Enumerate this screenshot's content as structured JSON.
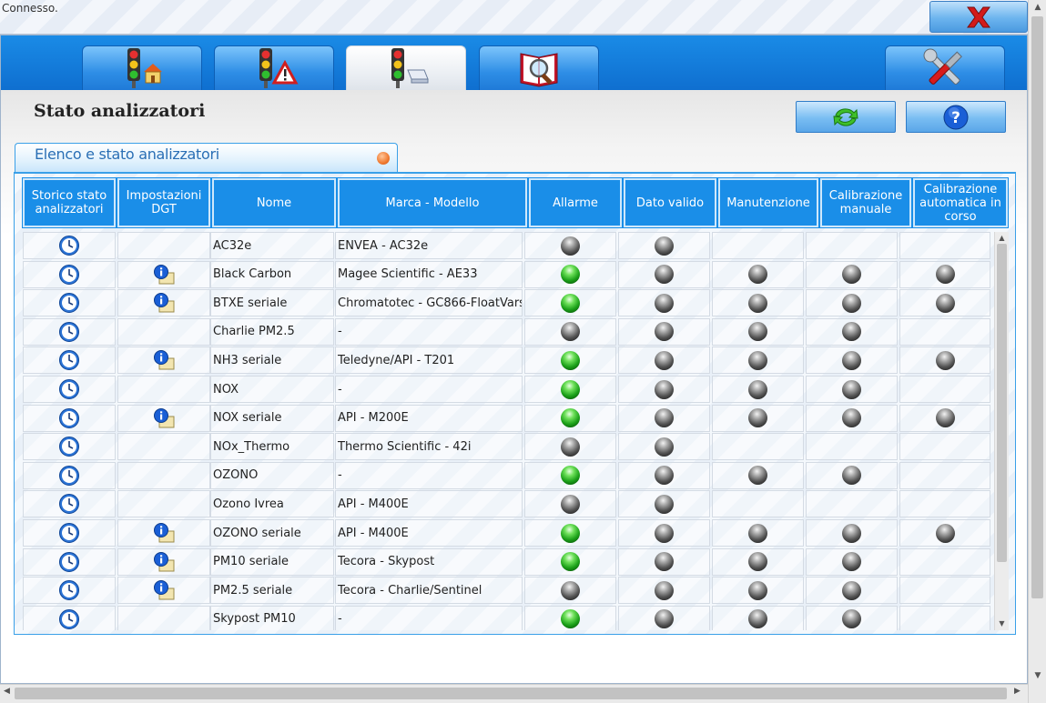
{
  "status": {
    "text": "Connesso."
  },
  "window": {
    "close_icon": "close-x-icon"
  },
  "tabs": [
    {
      "name": "tab-station-status",
      "icon": "traffic-light-home-icon",
      "active": false
    },
    {
      "name": "tab-alarms",
      "icon": "traffic-light-warning-icon",
      "active": false
    },
    {
      "name": "tab-analyzers",
      "icon": "traffic-light-device-icon",
      "active": true
    },
    {
      "name": "tab-data-search",
      "icon": "book-magnifier-icon",
      "active": false
    },
    {
      "name": "tab-settings",
      "icon": "tools-icon",
      "active": false
    }
  ],
  "page": {
    "title": "Stato analizzatori"
  },
  "buttons": {
    "refresh_icon": "refresh-icon",
    "help_icon": "help-icon"
  },
  "panel": {
    "title": "Elenco e stato analizzatori"
  },
  "table": {
    "headers": [
      "Storico stato analizzatori",
      "Impostazioni DGT",
      "Nome",
      "Marca - Modello",
      "Allarme",
      "Dato valido",
      "Manutenzione",
      "Calibrazione manuale",
      "Calibrazione automatica in corso"
    ],
    "rows": [
      {
        "info": false,
        "name": "AC32e",
        "model": "ENVEA - AC32e",
        "allarme": "grey",
        "valido": "grey",
        "manut": "",
        "calman": "",
        "calauto": ""
      },
      {
        "info": true,
        "name": "Black Carbon",
        "model": "Magee Scientific - AE33",
        "allarme": "green",
        "valido": "grey",
        "manut": "grey",
        "calman": "grey",
        "calauto": "grey"
      },
      {
        "info": true,
        "name": "BTXE seriale",
        "model": "Chromatotec - GC866-FloatVars",
        "allarme": "green",
        "valido": "grey",
        "manut": "grey",
        "calman": "grey",
        "calauto": "grey"
      },
      {
        "info": false,
        "name": "Charlie PM2.5",
        "model": "-",
        "allarme": "grey",
        "valido": "grey",
        "manut": "grey",
        "calman": "grey",
        "calauto": ""
      },
      {
        "info": true,
        "name": "NH3 seriale",
        "model": "Teledyne/API - T201",
        "allarme": "green",
        "valido": "grey",
        "manut": "grey",
        "calman": "grey",
        "calauto": "grey"
      },
      {
        "info": false,
        "name": "NOX",
        "model": "-",
        "allarme": "green",
        "valido": "grey",
        "manut": "grey",
        "calman": "grey",
        "calauto": ""
      },
      {
        "info": true,
        "name": "NOX seriale",
        "model": "API - M200E",
        "allarme": "green",
        "valido": "grey",
        "manut": "grey",
        "calman": "grey",
        "calauto": "grey"
      },
      {
        "info": false,
        "name": "NOx_Thermo",
        "model": "Thermo Scientific - 42i",
        "allarme": "grey",
        "valido": "grey",
        "manut": "",
        "calman": "",
        "calauto": ""
      },
      {
        "info": false,
        "name": "OZONO",
        "model": "-",
        "allarme": "green",
        "valido": "grey",
        "manut": "grey",
        "calman": "grey",
        "calauto": ""
      },
      {
        "info": false,
        "name": "Ozono Ivrea",
        "model": "API - M400E",
        "allarme": "grey",
        "valido": "grey",
        "manut": "",
        "calman": "",
        "calauto": ""
      },
      {
        "info": true,
        "name": "OZONO seriale",
        "model": "API - M400E",
        "allarme": "green",
        "valido": "grey",
        "manut": "grey",
        "calman": "grey",
        "calauto": "grey"
      },
      {
        "info": true,
        "name": "PM10 seriale",
        "model": "Tecora - Skypost",
        "allarme": "green",
        "valido": "grey",
        "manut": "grey",
        "calman": "grey",
        "calauto": ""
      },
      {
        "info": true,
        "name": "PM2.5 seriale",
        "model": "Tecora - Charlie/Sentinel",
        "allarme": "grey",
        "valido": "grey",
        "manut": "grey",
        "calman": "grey",
        "calauto": ""
      },
      {
        "info": false,
        "name": "Skypost PM10",
        "model": "-",
        "allarme": "green",
        "valido": "grey",
        "manut": "grey",
        "calman": "grey",
        "calauto": ""
      }
    ]
  }
}
